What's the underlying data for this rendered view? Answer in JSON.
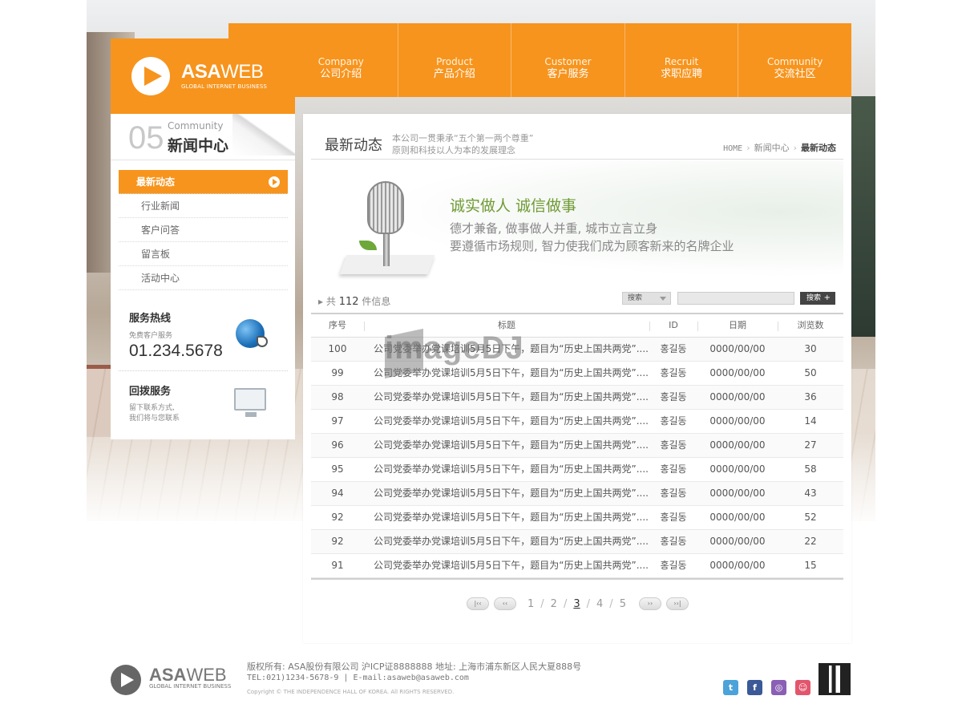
{
  "colors": {
    "accent": "#f7941d",
    "green": "#6f9a34"
  },
  "nav": [
    {
      "en": "Company",
      "cn": "公司介绍"
    },
    {
      "en": "Product",
      "cn": "产品介绍"
    },
    {
      "en": "Customer",
      "cn": "客户服务"
    },
    {
      "en": "Recruit",
      "cn": "求职应聘"
    },
    {
      "en": "Community",
      "cn": "交流社区"
    }
  ],
  "logo": {
    "bold": "ASA",
    "thin": "WEB",
    "sub": "GLOBAL INTERNET BUSINESS"
  },
  "sidebar": {
    "section_num": "05",
    "section_en": "Community",
    "section_cn": "新闻中心",
    "items": [
      {
        "label": "最新动态",
        "active": true
      },
      {
        "label": "行业新闻"
      },
      {
        "label": "客户问答"
      },
      {
        "label": "留言板"
      },
      {
        "label": "活动中心"
      }
    ],
    "hotline": {
      "title": "服务热线",
      "sub": "免费客户服务",
      "number": "01.234.5678"
    },
    "callback": {
      "title": "回拨服务",
      "sub1": "留下联系方式,",
      "sub2": "我们将与您联系"
    }
  },
  "main": {
    "title": "最新动态",
    "slogan1": "本公司一贯秉承“五个第一两个尊重”",
    "slogan2": "原则和科技以人为本的发展理念",
    "breadcrumb": {
      "home": "HOME",
      "mid": "新闻中心",
      "cur": "最新动态"
    },
    "motto": "诚实做人 诚信做事",
    "motto_sub1": "德才兼备, 做事做人并重, 城市立言立身",
    "motto_sub2": "要遵循市场规则, 智力使我们成为顾客新来的名牌企业",
    "count_prefix": "共",
    "count": "112",
    "count_suffix": "件信息",
    "search": {
      "select": "搜索",
      "button": "搜索"
    },
    "table": {
      "headers": {
        "no": "序号",
        "title": "标题",
        "id": "ID",
        "date": "日期",
        "views": "浏览数"
      },
      "rows": [
        {
          "no": "100",
          "title": "公司党委举办党课培训5月5日下午，题目为“历史上国共两党”....",
          "id": "홍길동",
          "date": "0000/00/00",
          "views": "30"
        },
        {
          "no": "99",
          "title": "公司党委举办党课培训5月5日下午，题目为“历史上国共两党”....",
          "id": "홍길동",
          "date": "0000/00/00",
          "views": "50"
        },
        {
          "no": "98",
          "title": "公司党委举办党课培训5月5日下午，题目为“历史上国共两党”....",
          "id": "홍길동",
          "date": "0000/00/00",
          "views": "36"
        },
        {
          "no": "97",
          "title": "公司党委举办党课培训5月5日下午，题目为“历史上国共两党”....",
          "id": "홍길동",
          "date": "0000/00/00",
          "views": "14"
        },
        {
          "no": "96",
          "title": "公司党委举办党课培训5月5日下午，题目为“历史上国共两党”....",
          "id": "홍길동",
          "date": "0000/00/00",
          "views": "27"
        },
        {
          "no": "95",
          "title": "公司党委举办党课培训5月5日下午，题目为“历史上国共两党”....",
          "id": "홍길동",
          "date": "0000/00/00",
          "views": "58"
        },
        {
          "no": "94",
          "title": "公司党委举办党课培训5月5日下午，题目为“历史上国共两党”....",
          "id": "홍길동",
          "date": "0000/00/00",
          "views": "43"
        },
        {
          "no": "92",
          "title": "公司党委举办党课培训5月5日下午，题目为“历史上国共两党”....",
          "id": "홍길동",
          "date": "0000/00/00",
          "views": "52"
        },
        {
          "no": "92",
          "title": "公司党委举办党课培训5月5日下午，题目为“历史上国共两党”....",
          "id": "홍길동",
          "date": "0000/00/00",
          "views": "22"
        },
        {
          "no": "91",
          "title": "公司党委举办党课培训5月5日下午，题目为“历史上国共两党”....",
          "id": "홍길동",
          "date": "0000/00/00",
          "views": "15"
        }
      ]
    },
    "pager": {
      "first": "|‹‹",
      "prev": "‹‹",
      "pages": [
        "1",
        "2",
        "3",
        "4",
        "5"
      ],
      "current": "3",
      "next": "››",
      "last": "››|"
    }
  },
  "watermark": "imageDJ",
  "footer": {
    "line1": "版权所有: ASA股份有限公司 沪ICP证8888888 地址: 上海市浦东新区人民大夏888号",
    "line2": "TEL:021)1234-5678-9 | E-mail:asaweb@asaweb.com",
    "line3": "Copyright © THE INDEPENDENCE HALL OF KOREA. All RIGHTS RESERVED.",
    "social": [
      {
        "icon": "twitter-icon",
        "glyph": "t",
        "color": "#4ba3d9"
      },
      {
        "icon": "facebook-icon",
        "glyph": "f",
        "color": "#3b5998"
      },
      {
        "icon": "message-icon",
        "glyph": "◎",
        "color": "#8a5fb5"
      },
      {
        "icon": "community-icon",
        "glyph": "☺",
        "color": "#e2566d"
      }
    ]
  }
}
